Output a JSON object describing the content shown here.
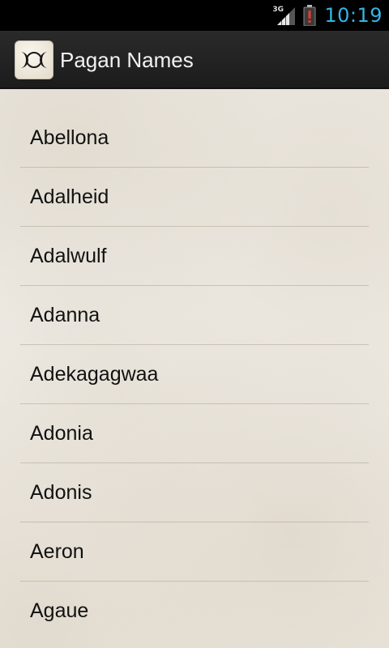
{
  "status_bar": {
    "network_type": "3G",
    "signal_icon": "signal-bars-icon",
    "battery_icon": "battery-alert-icon",
    "time": "10:19",
    "time_color": "#33b5e5"
  },
  "action_bar": {
    "app_icon": "triple-moon-icon",
    "title": "Pagan Names"
  },
  "names": [
    "Abellona",
    "Adalheid",
    "Adalwulf",
    "Adanna",
    "Adekagagwaa",
    "Adonia",
    "Adonis",
    "Aeron",
    "Agaue"
  ]
}
